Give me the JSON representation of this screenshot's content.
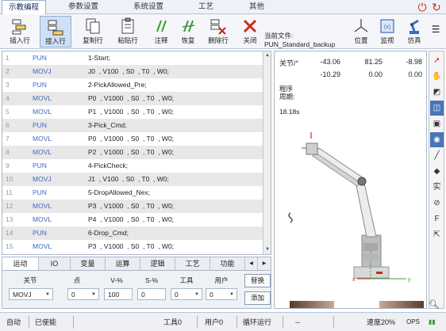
{
  "menu": {
    "tabs": [
      "示教编程",
      "参数设置",
      "系统设置",
      "工艺",
      "其他"
    ],
    "active_index": 0
  },
  "toolbar": {
    "buttons": [
      {
        "label": "插入行",
        "icon": "insert-row-icon"
      },
      {
        "label": "接入行",
        "icon": "append-row-icon"
      },
      {
        "label": "复制行",
        "icon": "copy-row-icon"
      },
      {
        "label": "粘贴行",
        "icon": "paste-row-icon"
      },
      {
        "label": "注释",
        "icon": "comment-icon"
      },
      {
        "label": "恢复",
        "icon": "restore-icon"
      },
      {
        "label": "删除行",
        "icon": "delete-row-icon"
      },
      {
        "label": "关闭",
        "icon": "close-icon"
      }
    ],
    "current_file_label": "当前文件:",
    "current_file": "PUN_Standard_backup",
    "position_label": "位置",
    "monitor_label": "监视",
    "simulate_label": "仿真"
  },
  "program": {
    "rows": [
      {
        "n": "1",
        "cmd": "PUN",
        "arg": "1-Start;"
      },
      {
        "n": "2",
        "cmd": "MOVJ",
        "arg": "J0  , V100  , S0  , T0  , W0;"
      },
      {
        "n": "3",
        "cmd": "PUN",
        "arg": "2-PickAllowed_Pre;"
      },
      {
        "n": "4",
        "cmd": "MOVL",
        "arg": "P0  , V1000  , S0  , T0  , W0;"
      },
      {
        "n": "5",
        "cmd": "MOVL",
        "arg": "P1  , V1000  , S0  , T0  , W0;"
      },
      {
        "n": "6",
        "cmd": "PUN",
        "arg": "3-Pick_Cmd;"
      },
      {
        "n": "7",
        "cmd": "MOVL",
        "arg": "P0  , V1000  , S0  , T0  , W0;"
      },
      {
        "n": "8",
        "cmd": "MOVL",
        "arg": "P2  , V1000  , S0  , T0  , W0;"
      },
      {
        "n": "9",
        "cmd": "PUN",
        "arg": "4-PickCheck;"
      },
      {
        "n": "10",
        "cmd": "MOVJ",
        "arg": "J1  , V100  , S0  , T0  , W0;"
      },
      {
        "n": "11",
        "cmd": "PUN",
        "arg": "5-DropAllowed_Nex;"
      },
      {
        "n": "12",
        "cmd": "MOVL",
        "arg": "P3  , V1000  , S0  , T0  , W0;"
      },
      {
        "n": "13",
        "cmd": "MOVL",
        "arg": "P4  , V1000  , S0  , T0  , W0;"
      },
      {
        "n": "14",
        "cmd": "PUN",
        "arg": "6-Drop_Cmd;"
      },
      {
        "n": "15",
        "cmd": "MOVL",
        "arg": "P3  , V1000  , S0  , T0  , W0;"
      }
    ]
  },
  "bottom_tabs": {
    "tabs": [
      "运动",
      "IO",
      "变量",
      "运算",
      "逻辑",
      "工艺",
      "功能"
    ],
    "active_index": 0
  },
  "editor": {
    "headers": [
      "关节",
      "点",
      "V-%",
      "S-%",
      "工具",
      "用户"
    ],
    "values": [
      "MOVJ",
      "0",
      "100",
      "0",
      "0",
      "0"
    ],
    "replace_label": "替换",
    "add_label": "添加"
  },
  "joints": {
    "label": "关节/°",
    "row1": [
      "-43.06",
      "81.25",
      "-8.98"
    ],
    "row2": [
      "-10.29",
      "0.00",
      "0.00"
    ],
    "period_label_1": "程序",
    "period_label_2": "周期:",
    "period_value": "18.18s"
  },
  "sidebar": {
    "items": [
      "cursor-icon",
      "hand-icon",
      "view-front-icon",
      "view-top-icon",
      "view-side-icon",
      "eye-icon",
      "pen-icon",
      "eraser-icon",
      "solid-text",
      "hide-icon",
      "f-text",
      "export-icon"
    ],
    "solid_label": "实",
    "f_label": "F"
  },
  "status": {
    "mode": "自动",
    "enabled": "已使能",
    "tool": "工具0",
    "user": "用户0",
    "run_mode": "循环运行",
    "dash": "--",
    "speed": "速度20%",
    "ops": "OPS"
  }
}
